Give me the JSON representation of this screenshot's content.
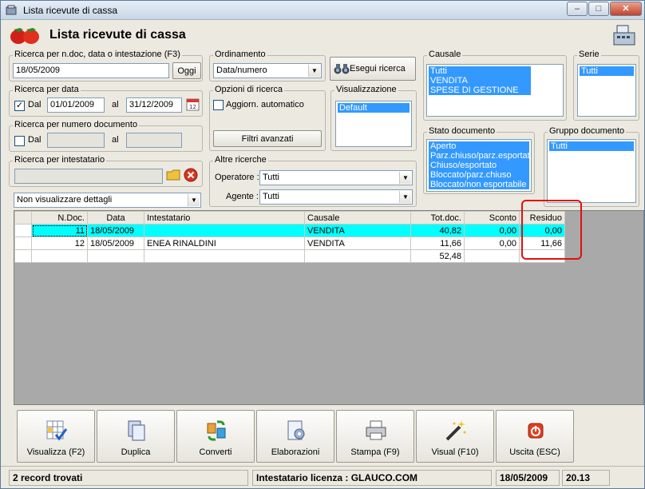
{
  "window": {
    "title": "Lista ricevute di cassa",
    "minimize": "–",
    "maximize": "□",
    "close": "✕"
  },
  "header": {
    "title": "Lista ricevute di cassa"
  },
  "search_ndoc": {
    "legend": "Ricerca per n.doc, data o intestazione (F3)",
    "value": "18/05/2009",
    "today_button": "Oggi"
  },
  "search_date": {
    "legend": "Ricerca per data",
    "dal_label": "Dal",
    "dal_checked": true,
    "dal_value": "01/01/2009",
    "al_label": "al",
    "al_value": "31/12/2009"
  },
  "search_number": {
    "legend": "Ricerca per numero documento",
    "dal_label": "Dal",
    "al_label": "al",
    "dal_value": "",
    "al_value": ""
  },
  "search_holder": {
    "legend": "Ricerca per intestatario",
    "value": ""
  },
  "details_combo": {
    "value": "Non visualizzare dettagli"
  },
  "sorting": {
    "legend": "Ordinamento",
    "value": "Data/numero"
  },
  "execute_search": {
    "label": "Esegui ricerca"
  },
  "search_options": {
    "legend": "Opzioni di ricerca",
    "auto_update_label": "Aggiorn. automatico",
    "auto_update_checked": false,
    "advanced_filters": "Filtri avanzati"
  },
  "display": {
    "legend": "Visualizzazione",
    "items": [
      {
        "label": "Default",
        "selected": true
      }
    ]
  },
  "other_searches": {
    "legend": "Altre ricerche",
    "operator_label": "Operatore :",
    "operator_value": "Tutti",
    "agent_label": "Agente :",
    "agent_value": "Tutti"
  },
  "causale": {
    "legend": "Causale",
    "items": [
      {
        "label": "Tutti",
        "selected": true
      },
      {
        "label": "VENDITA",
        "selected": true
      },
      {
        "label": "SPESE DI GESTIONE",
        "selected": true
      }
    ]
  },
  "serie": {
    "legend": "Serie",
    "items": [
      {
        "label": "Tutti",
        "selected": true
      }
    ]
  },
  "doc_status": {
    "legend": "Stato documento",
    "items": [
      {
        "label": "Aperto",
        "selected": true
      },
      {
        "label": "Parz.chiuso/parz.esportato",
        "selected": true
      },
      {
        "label": "Chiuso/esportato",
        "selected": true
      },
      {
        "label": "Bloccato/parz.chiuso",
        "selected": true
      },
      {
        "label": "Bloccato/non esportabile",
        "selected": true
      }
    ]
  },
  "doc_group": {
    "legend": "Gruppo documento",
    "items": [
      {
        "label": "Tutti",
        "selected": true
      }
    ]
  },
  "grid": {
    "columns": [
      "",
      "N.Doc.",
      "Data",
      "Intestatario",
      "Causale",
      "Tot.doc.",
      "Sconto",
      "Residuo"
    ],
    "rows": [
      {
        "ndoc": "11",
        "data": "18/05/2009",
        "intestatario": "",
        "causale": "VENDITA",
        "totdoc": "40,82",
        "sconto": "0,00",
        "residuo": "0,00"
      },
      {
        "ndoc": "12",
        "data": "18/05/2009",
        "intestatario": "ENEA RINALDINI",
        "causale": "VENDITA",
        "totdoc": "11,66",
        "sconto": "0,00",
        "residuo": "11,66"
      }
    ],
    "total": "52,48"
  },
  "toolbar": {
    "buttons": [
      {
        "label": "Visualizza (F2)",
        "icon": "view-grid-icon"
      },
      {
        "label": "Duplica",
        "icon": "duplicate-icon"
      },
      {
        "label": "Converti",
        "icon": "convert-icon"
      },
      {
        "label": "Elaborazioni",
        "icon": "processing-icon"
      },
      {
        "label": "Stampa (F9)",
        "icon": "printer-icon"
      },
      {
        "label": "Visual (F10)",
        "icon": "magic-wand-icon"
      },
      {
        "label": "Uscita (ESC)",
        "icon": "exit-icon"
      }
    ]
  },
  "status": {
    "records": "2 record trovati",
    "licensee": "Intestatario licenza : GLAUCO.COM",
    "date": "18/05/2009",
    "time": "20.13"
  },
  "colors": {
    "selection": "#3399ff",
    "active_row": "#00ffff",
    "highlight": "#e01010"
  }
}
